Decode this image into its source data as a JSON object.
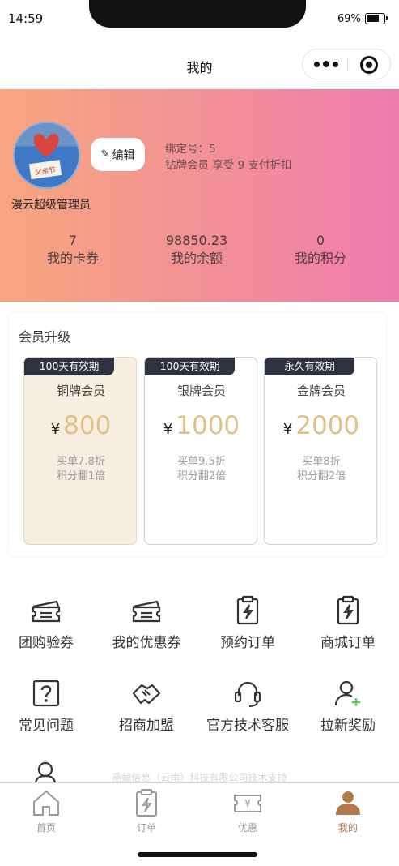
{
  "status_bar": {
    "time": "14:59",
    "battery": "69%"
  },
  "nav": {
    "title": "我的"
  },
  "profile": {
    "username": "漫云超级管理员",
    "edit_label": "编辑",
    "bind_line": "绑定号：5",
    "member_line": "钻牌会员 享受 9 支付折扣",
    "stats": [
      {
        "value": "7",
        "label": "我的卡券"
      },
      {
        "value": "98850.23",
        "label": "我的余额"
      },
      {
        "value": "0",
        "label": "我的积分"
      }
    ]
  },
  "upgrade": {
    "title": "会员升级",
    "currency": "¥",
    "tiers": [
      {
        "tag": "100天有效期",
        "name": "铜牌会员",
        "price": "800",
        "desc1": "买单7.8折",
        "desc2": "积分翻1倍",
        "active": true
      },
      {
        "tag": "100天有效期",
        "name": "银牌会员",
        "price": "1000",
        "desc1": "买单9.5折",
        "desc2": "积分翻2倍",
        "active": false
      },
      {
        "tag": "永久有效期",
        "name": "金牌会员",
        "price": "2000",
        "desc1": "买单8折",
        "desc2": "积分翻2倍",
        "active": false
      }
    ]
  },
  "menu": [
    {
      "label": "团购验券",
      "icon": "ticket-icon"
    },
    {
      "label": "我的优惠券",
      "icon": "coupon-icon"
    },
    {
      "label": "预约订单",
      "icon": "clipboard-bolt-icon"
    },
    {
      "label": "商城订单",
      "icon": "clipboard-bolt-icon"
    },
    {
      "label": "常见问题",
      "icon": "question-icon"
    },
    {
      "label": "招商加盟",
      "icon": "handshake-icon"
    },
    {
      "label": "官方技术客服",
      "icon": "headset-icon"
    },
    {
      "label": "拉新奖励",
      "icon": "user-add-icon"
    }
  ],
  "support_text": "燕鲸信息（云南）科技有限公司技术支持",
  "tabs": [
    {
      "label": "首页",
      "icon": "home-icon",
      "active": false
    },
    {
      "label": "订单",
      "icon": "order-icon",
      "active": false
    },
    {
      "label": "优惠",
      "icon": "discount-icon",
      "active": false
    },
    {
      "label": "我的",
      "icon": "user-icon",
      "active": true
    }
  ],
  "colors": {
    "header_gradient_start": "#f7a67f",
    "header_gradient_end": "#ef7bb0",
    "price_gold": "#e0c288",
    "tag_dark": "#2e3140",
    "tab_active": "#b07a4a",
    "add_green": "#5ec95e"
  }
}
